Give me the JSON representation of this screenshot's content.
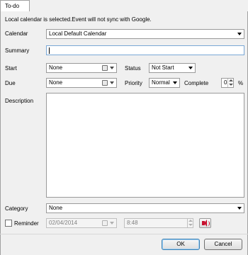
{
  "tab": {
    "label": "To-do"
  },
  "notice": "Local calendar is selected.Event will not sync with Google.",
  "calendar": {
    "label": "Calendar",
    "value": "Local Default Calendar"
  },
  "summary": {
    "label": "Summary",
    "value": ""
  },
  "start": {
    "label": "Start",
    "value": "None"
  },
  "status": {
    "label": "Status",
    "value": "Not Start"
  },
  "due": {
    "label": "Due",
    "value": "None"
  },
  "priority": {
    "label": "Priority",
    "value": "Normal"
  },
  "complete": {
    "label": "Complete",
    "value": "0",
    "unit": "%"
  },
  "description": {
    "label": "Description",
    "value": ""
  },
  "category": {
    "label": "Category",
    "value": "None"
  },
  "reminder": {
    "label": "Reminder",
    "checked": false,
    "date": "02/04/2014",
    "time": "8:48"
  },
  "buttons": {
    "ok": "OK",
    "cancel": "Cancel"
  },
  "icons": {
    "calendar_picker": "calendar-icon",
    "sound": "speaker-icon"
  },
  "colors": {
    "focus_border": "#7aa7d6",
    "speaker": "#c8102e"
  }
}
